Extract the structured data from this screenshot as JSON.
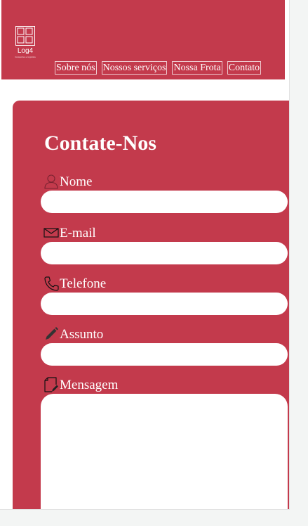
{
  "header": {
    "logo_name": "Log4",
    "logo_tagline": "transportes e logística"
  },
  "nav": {
    "items": [
      "Sobre nós",
      "Nossos serviços",
      "Nossa Frota",
      "Contato"
    ]
  },
  "form": {
    "title": "Contate-Nos",
    "fields": [
      {
        "label": "Nome",
        "icon": "user-icon",
        "value": "",
        "placeholder": ""
      },
      {
        "label": "E-mail",
        "icon": "envelope-icon",
        "value": "",
        "placeholder": ""
      },
      {
        "label": "Telefone",
        "icon": "phone-icon",
        "value": "",
        "placeholder": ""
      },
      {
        "label": "Assunto",
        "icon": "pencil-icon",
        "value": "",
        "placeholder": ""
      },
      {
        "label": "Mensagem",
        "icon": "document-edit-icon",
        "value": "",
        "placeholder": ""
      }
    ]
  },
  "colors": {
    "brand": "#c33a4c",
    "background": "#ffffff",
    "outer": "#f3f5f4"
  }
}
